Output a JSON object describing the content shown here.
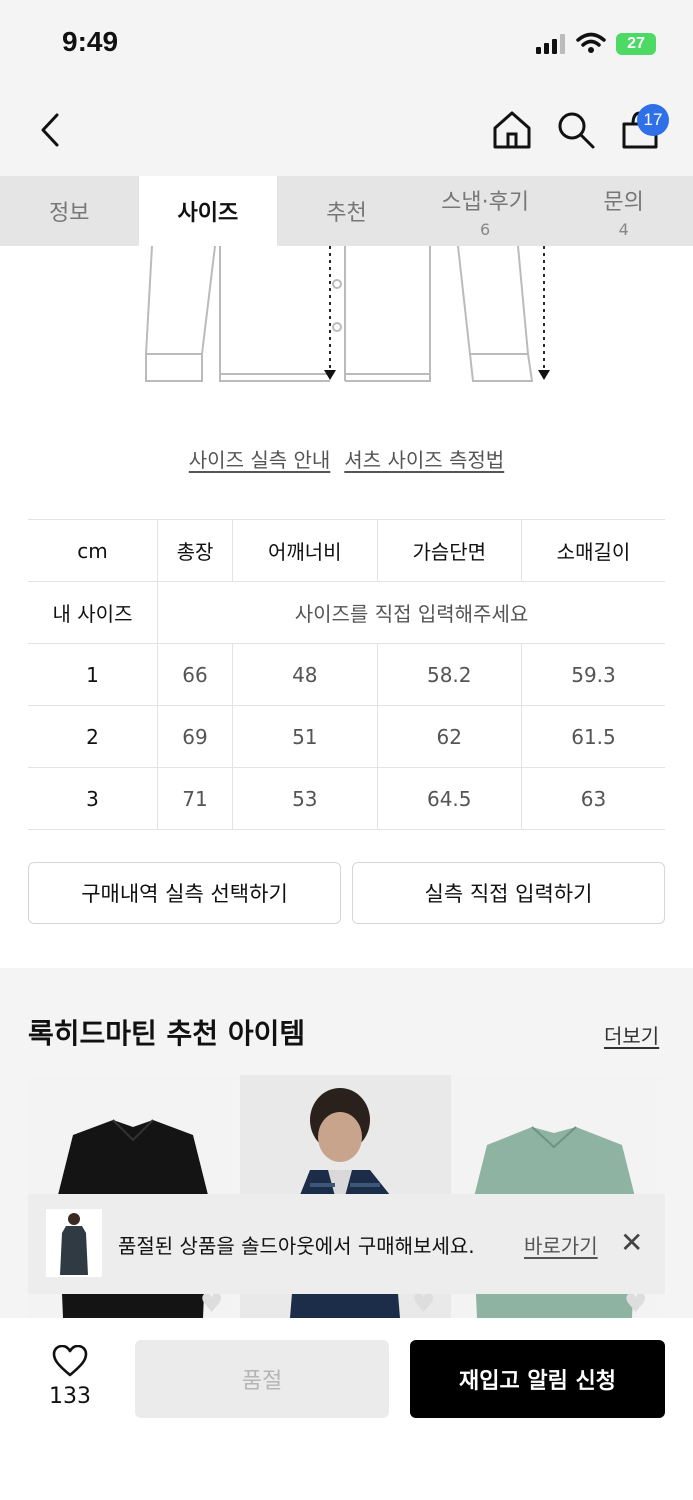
{
  "status_bar": {
    "time": "9:49",
    "battery": "27"
  },
  "header": {
    "cart_count": "17"
  },
  "tabs": [
    {
      "label": "정보",
      "count": ""
    },
    {
      "label": "사이즈",
      "count": ""
    },
    {
      "label": "추천",
      "count": ""
    },
    {
      "label": "스냅·후기",
      "count": "6"
    },
    {
      "label": "문의",
      "count": "4"
    }
  ],
  "links": {
    "size_guide": "사이즈 실측 안내",
    "shirt_measure": "셔츠 사이즈 측정법"
  },
  "size_table": {
    "unit": "cm",
    "columns": [
      "총장",
      "어깨너비",
      "가슴단면",
      "소매길이"
    ],
    "my_size_label": "내 사이즈",
    "my_size_placeholder": "사이즈를 직접 입력해주세요",
    "rows": [
      {
        "size": "1",
        "values": [
          "66",
          "48",
          "58.2",
          "59.3"
        ]
      },
      {
        "size": "2",
        "values": [
          "69",
          "51",
          "62",
          "61.5"
        ]
      },
      {
        "size": "3",
        "values": [
          "71",
          "53",
          "64.5",
          "63"
        ]
      }
    ]
  },
  "buttons": {
    "select_purchase": "구매내역 실측 선택하기",
    "direct_input": "실측 직접 입력하기"
  },
  "recommend": {
    "title": "록히드마틴 추천 아이템",
    "more": "더보기"
  },
  "toast": {
    "text": "품절된 상품을 솔드아웃에서 구매해보세요.",
    "link": "바로가기"
  },
  "bottom": {
    "like_count": "133",
    "soldout": "품절",
    "restock": "재입고 알림 신청"
  },
  "colors": {
    "badge": "#2f6fe8",
    "battery": "#4cd964",
    "primary_button": "#000000",
    "disabled_button": "#ebebeb"
  }
}
